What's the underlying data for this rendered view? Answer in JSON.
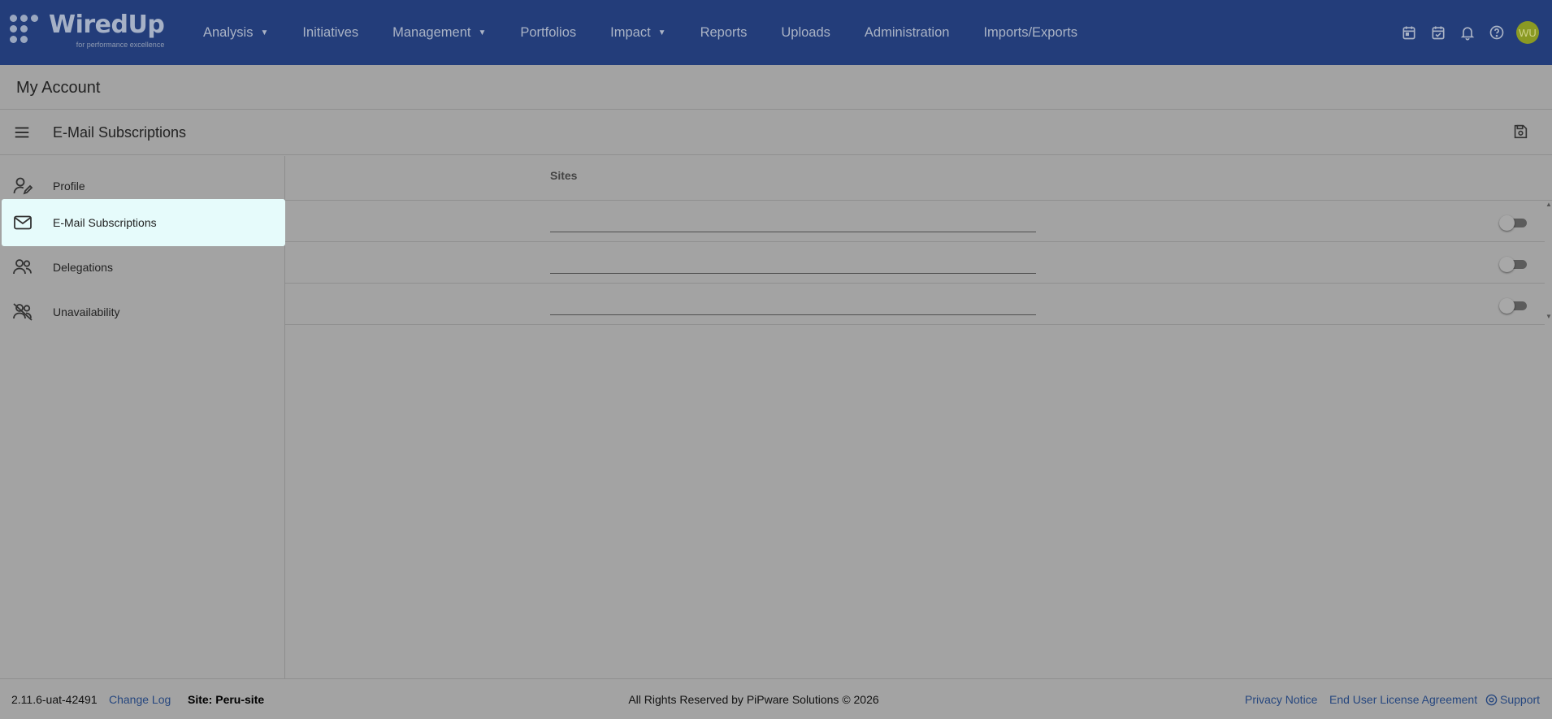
{
  "app": {
    "logo_text": "WiredUp",
    "logo_tagline": "for performance excellence"
  },
  "nav": {
    "items": [
      {
        "label": "Analysis",
        "has_dropdown": true
      },
      {
        "label": "Initiatives",
        "has_dropdown": false
      },
      {
        "label": "Management",
        "has_dropdown": true
      },
      {
        "label": "Portfolios",
        "has_dropdown": false
      },
      {
        "label": "Impact",
        "has_dropdown": true
      },
      {
        "label": "Reports",
        "has_dropdown": false
      },
      {
        "label": "Uploads",
        "has_dropdown": false
      },
      {
        "label": "Administration",
        "has_dropdown": false
      },
      {
        "label": "Imports/Exports",
        "has_dropdown": false
      }
    ],
    "caret": "▼",
    "icons": [
      "calendar-icon",
      "calendar-check-icon",
      "bell-icon",
      "help-icon"
    ],
    "avatar_initials": "WU",
    "avatar_color": "#8a9a23"
  },
  "page": {
    "title": "My Account"
  },
  "section": {
    "title": "E-Mail Subscriptions",
    "menu_icon": "hamburger-menu-icon",
    "save_icon": "save-icon"
  },
  "sidebar": {
    "items": [
      {
        "label": "Profile",
        "icon": "user-edit-icon",
        "active": false
      },
      {
        "label": "E-Mail Subscriptions",
        "icon": "envelope-icon",
        "active": true
      },
      {
        "label": "Delegations",
        "icon": "users-icon",
        "active": false
      },
      {
        "label": "Unavailability",
        "icon": "users-off-icon",
        "active": false
      }
    ]
  },
  "table": {
    "column_header": "Sites",
    "rows": [
      {
        "site": "",
        "subscribed": false
      },
      {
        "site": "",
        "subscribed": false
      },
      {
        "site": "",
        "subscribed": false
      }
    ]
  },
  "footer": {
    "version": "2.11.6-uat-42491",
    "change_log": "Change Log",
    "site": "Site: Peru-site",
    "rights": "All Rights Reserved by PiPware Solutions © 2026",
    "privacy": "Privacy Notice",
    "eula": "End User License Agreement",
    "support": "Support"
  },
  "colors": {
    "topbar": "#233d7a",
    "overlay_background": "#a3a3a3",
    "active_item": "#e6fbfb",
    "link": "#26477f"
  }
}
